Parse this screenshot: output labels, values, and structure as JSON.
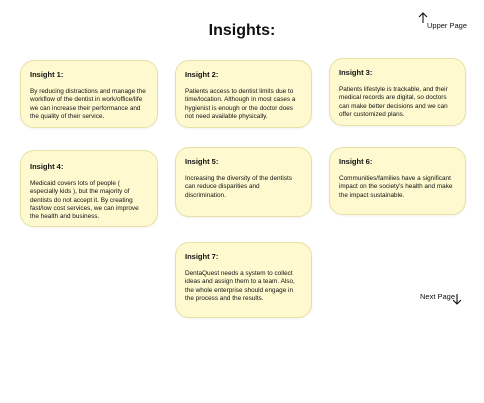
{
  "header": {
    "title": "Insights:",
    "upper_page_label": "Upper Page",
    "next_page_label": "Next Page"
  },
  "insights": [
    {
      "title": "Insight 1:",
      "body": "By reducing distractions and manage the workflow of the dentist in work/office/life we can increase their performance and the quality of their service."
    },
    {
      "title": "Insight 2:",
      "body": "Patients access to dentist limits due to time/location. Although in most cases a hygienist is enough or the doctor does not need available physically."
    },
    {
      "title": "Insight 3:",
      "body": "Patients lifestyle is trackable, and their medical records are digital, so doctors can make better decisions and we can offer customized plans."
    },
    {
      "title": "Insight 4:",
      "body": "Medicaid covers lots of people ( especially kids ), but the majority of dentists do not accept it. By creating fast/low cost services, we can improve the health and business."
    },
    {
      "title": "Insight 5:",
      "body": "Increasing the diversity of the dentists can reduce disparities and discrimination."
    },
    {
      "title": "Insight 6:",
      "body": "Communities/families have a significant impact on the society's health and make the impact sustainable."
    },
    {
      "title": "Insight 7:",
      "body": "DentaQuest needs a system to collect ideas and assign them to a team. Also, the whole enterprise should engage in the process and the results."
    }
  ],
  "icons": {
    "upper": "arrow-up-icon",
    "next": "arrow-down-icon"
  },
  "colors": {
    "card_fill": "#fef9cf",
    "card_border": "#e7e1a4",
    "text": "#111111"
  }
}
